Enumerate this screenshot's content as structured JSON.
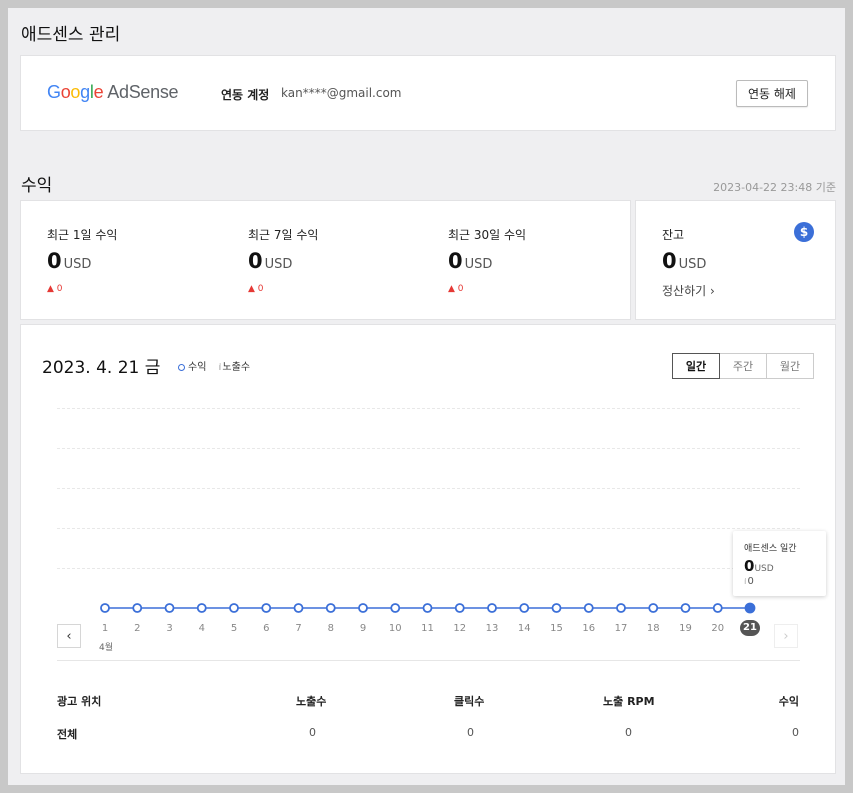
{
  "page_title": "애드센스 관리",
  "account": {
    "logo_google": [
      "G",
      "o",
      "o",
      "g",
      "l",
      "e"
    ],
    "logo_product": "AdSense",
    "linked_label": "연동 계정",
    "linked_email": "kan****@gmail.com",
    "unlink_button": "연동 해제"
  },
  "revenue": {
    "title": "수익",
    "basis_time": "2023-04-22 23:48 기준",
    "stats": [
      {
        "label": "최근 1일 수익",
        "value": "0",
        "unit": "USD",
        "change": "▲ 0"
      },
      {
        "label": "최근 7일 수익",
        "value": "0",
        "unit": "USD",
        "change": "▲ 0"
      },
      {
        "label": "최근 30일 수익",
        "value": "0",
        "unit": "USD",
        "change": "▲ 0"
      }
    ],
    "balance": {
      "label": "잔고",
      "value": "0",
      "unit": "USD",
      "settle_link": "정산하기 ›",
      "icon": "dollar-icon",
      "icon_glyph": "$"
    }
  },
  "chart": {
    "date_title": "2023. 4. 21 금",
    "legend_revenue": "수익",
    "legend_impressions": "노출수",
    "tabs": [
      {
        "label": "일간",
        "active": true
      },
      {
        "label": "주간",
        "active": false
      },
      {
        "label": "월간",
        "active": false
      }
    ],
    "prev_label": "‹",
    "next_label": "›",
    "month_label": "4월",
    "tooltip": {
      "title": "애드센스 일간",
      "value": "0",
      "unit": "USD",
      "impressions": "0",
      "bars_glyph": "ıl"
    },
    "accent_color": "#3b6fd8"
  },
  "chart_data": {
    "type": "line",
    "x": [
      "1",
      "2",
      "3",
      "4",
      "5",
      "6",
      "7",
      "8",
      "9",
      "10",
      "11",
      "12",
      "13",
      "14",
      "15",
      "16",
      "17",
      "18",
      "19",
      "20",
      "21"
    ],
    "series": [
      {
        "name": "수익",
        "values": [
          0,
          0,
          0,
          0,
          0,
          0,
          0,
          0,
          0,
          0,
          0,
          0,
          0,
          0,
          0,
          0,
          0,
          0,
          0,
          0,
          0
        ]
      }
    ],
    "selected_index": 20,
    "grid": true
  },
  "table": {
    "headers": [
      "광고 위치",
      "노출수",
      "클릭수",
      "노출 RPM",
      "수익"
    ],
    "rows": [
      [
        "전체",
        "0",
        "0",
        "0",
        "0"
      ]
    ]
  }
}
